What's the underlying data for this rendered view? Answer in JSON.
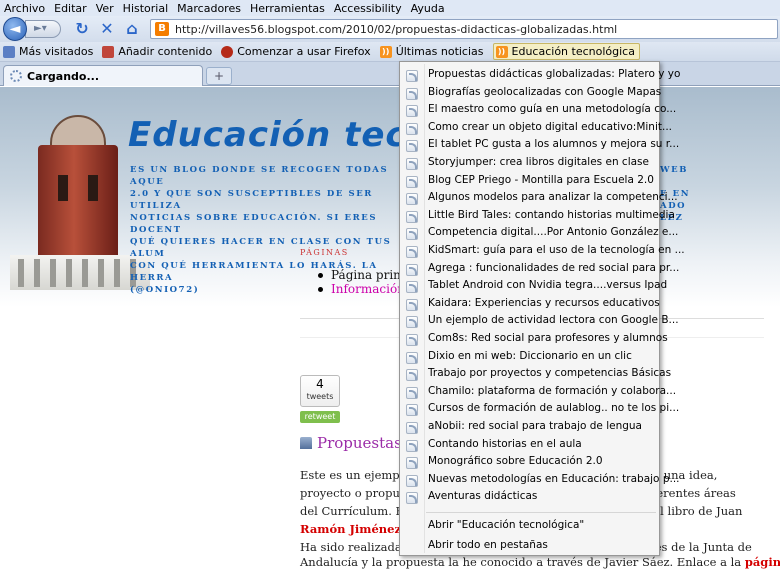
{
  "menubar": [
    "Archivo",
    "Editar",
    "Ver",
    "Historial",
    "Marcadores",
    "Herramientas",
    "Accessibility",
    "Ayuda"
  ],
  "url": "http://villaves56.blogspot.com/2010/02/propuestas-didacticas-globalizadas.html",
  "bookmarks": {
    "mas_visitados": "Más visitados",
    "anadir": "Añadir contenido",
    "firefox": "Comenzar a usar Firefox",
    "noticias": "Últimas noticias",
    "educacion": "Educación tecnológica"
  },
  "tab": {
    "title": "Cargando..."
  },
  "blog": {
    "title": "Educación tec",
    "desc_lines": [
      "ES UN BLOG DONDE SE RECOGEN TODAS AQUE",
      "2.0 Y QUE SON SUSCEPTIBLES DE SER UTILIZA",
      "NOTICIAS SOBRE EDUCACIÓN. SI ERES DOCENT",
      "QUÉ QUIERES HACER EN CLASE CON TUS ALUM",
      "CON QUÉ HERRAMIENTA LO HARÁS. LA HERRA",
      "(@ONIO72)"
    ],
    "desc_right": [
      "WEB",
      "",
      "E EN",
      "ADO",
      "LEZ"
    ]
  },
  "pages": {
    "heading": "PÁGINAS",
    "items": [
      "Página princi",
      "Información"
    ]
  },
  "tweets": {
    "count": "4",
    "label": "tweets",
    "retweet": "retweet"
  },
  "post": {
    "title": "Propuestas d",
    "left_lines": [
      "Este es un ejemplo d",
      "proyecto o propues",
      "del Currículum. En e",
      "Ramón Jiménez",
      "Ha sido realizada po"
    ],
    "right_lines": [
      "ase a una idea,",
      "n diferentes áreas",
      "ra del libro de Juan",
      "",
      "erroes de la Junta de"
    ],
    "bottom_line": "Andalucía y la propuesta la he conocido a través de Javier Sáez. Enlace a la",
    "bottom_link": "página de"
  },
  "dropdown": {
    "items": [
      "Propuestas didácticas globalizadas: Platero y yo",
      "Biografías geolocalizadas con Google Mapas",
      "El maestro como guía en una metodología co...",
      "Como crear un objeto digital educativo:Minit...",
      "El tablet PC gusta a los alumnos y mejora su r...",
      "Storyjumper: crea libros digitales en clase",
      "Blog CEP Priego - Montilla para Escuela 2.0",
      "Algunos modelos para analizar la competenci...",
      "Little Bird Tales: contando historias multimedia",
      "Competencia digital....Por Antonio González e...",
      "KidSmart: guía para el uso de la tecnología en ...",
      "Agrega : funcionalidades de red social para pr...",
      "Tablet Android con Nvidia tegra....versus Ipad",
      "Kaidara: Experiencias y recursos educativos",
      "Un ejemplo de actividad lectora con Google B...",
      "Com8s: Red social para profesores y alumnos",
      "Dixio en mi web: Diccionario en un clic",
      "Trabajo por proyectos y competencias Básicas",
      "Chamilo: plataforma de formación y colabora...",
      "Cursos de formación de aulablog.. no te los pi...",
      "aNobii: red social para trabajo de lengua",
      "Contando historias en el aula",
      "Monográfico sobre Educación 2.0",
      "Nuevas metodologías en Educación: trabajo p...",
      "Aventuras didácticas"
    ],
    "open": "Abrir \"Educación tecnológica\"",
    "open_all": "Abrir todo en pestañas"
  }
}
